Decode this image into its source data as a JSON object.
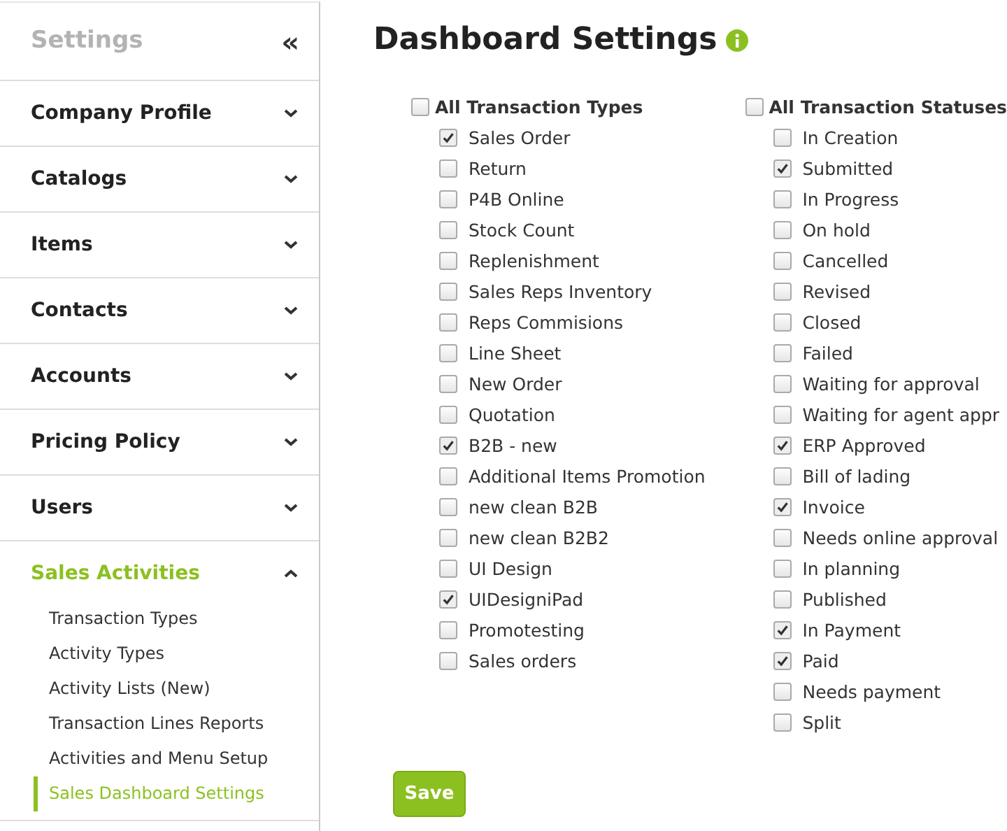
{
  "sidebar": {
    "title": "Settings",
    "collapse_icon": "«",
    "sections": [
      {
        "label": "Company Profile",
        "expanded": false
      },
      {
        "label": "Catalogs",
        "expanded": false
      },
      {
        "label": "Items",
        "expanded": false
      },
      {
        "label": "Contacts",
        "expanded": false
      },
      {
        "label": "Accounts",
        "expanded": false
      },
      {
        "label": "Pricing Policy",
        "expanded": false
      },
      {
        "label": "Users",
        "expanded": false
      },
      {
        "label": "Sales Activities",
        "expanded": true,
        "children": [
          {
            "label": "Transaction Types",
            "selected": false
          },
          {
            "label": "Activity Types",
            "selected": false
          },
          {
            "label": "Activity Lists (New)",
            "selected": false
          },
          {
            "label": "Transaction Lines Reports",
            "selected": false
          },
          {
            "label": "Activities and Menu Setup",
            "selected": false
          },
          {
            "label": "Sales Dashboard Settings",
            "selected": true
          }
        ]
      }
    ]
  },
  "page": {
    "title": "Dashboard Settings",
    "groups": [
      {
        "label": "All Transaction Types",
        "checked": false,
        "items": [
          {
            "label": "Sales Order",
            "checked": true
          },
          {
            "label": "Return",
            "checked": false
          },
          {
            "label": "P4B Online",
            "checked": false
          },
          {
            "label": "Stock Count",
            "checked": false
          },
          {
            "label": "Replenishment",
            "checked": false
          },
          {
            "label": "Sales Reps Inventory",
            "checked": false
          },
          {
            "label": "Reps Commisions",
            "checked": false
          },
          {
            "label": "Line Sheet",
            "checked": false
          },
          {
            "label": "New Order",
            "checked": false
          },
          {
            "label": "Quotation",
            "checked": false
          },
          {
            "label": "B2B - new",
            "checked": true
          },
          {
            "label": "Additional Items Promotion",
            "checked": false
          },
          {
            "label": "new clean B2B",
            "checked": false
          },
          {
            "label": "new clean B2B2",
            "checked": false
          },
          {
            "label": "UI Design",
            "checked": false
          },
          {
            "label": "UIDesigniPad",
            "checked": true
          },
          {
            "label": "Promotesting",
            "checked": false
          },
          {
            "label": "Sales orders",
            "checked": false
          }
        ]
      },
      {
        "label": "All Transaction Statuses",
        "checked": false,
        "items": [
          {
            "label": "In Creation",
            "checked": false
          },
          {
            "label": "Submitted",
            "checked": true
          },
          {
            "label": "In Progress",
            "checked": false
          },
          {
            "label": "On hold",
            "checked": false
          },
          {
            "label": "Cancelled",
            "checked": false
          },
          {
            "label": "Revised",
            "checked": false
          },
          {
            "label": "Closed",
            "checked": false
          },
          {
            "label": "Failed",
            "checked": false
          },
          {
            "label": "Waiting for approval",
            "checked": false
          },
          {
            "label": "Waiting for agent appr",
            "checked": false
          },
          {
            "label": "ERP Approved",
            "checked": true
          },
          {
            "label": "Bill of lading",
            "checked": false
          },
          {
            "label": "Invoice",
            "checked": true
          },
          {
            "label": "Needs online approval",
            "checked": false
          },
          {
            "label": "In planning",
            "checked": false
          },
          {
            "label": "Published",
            "checked": false
          },
          {
            "label": "In Payment",
            "checked": true
          },
          {
            "label": "Paid",
            "checked": true
          },
          {
            "label": "Needs payment",
            "checked": false
          },
          {
            "label": "Split",
            "checked": false
          }
        ]
      }
    ],
    "save_button": "Save"
  }
}
